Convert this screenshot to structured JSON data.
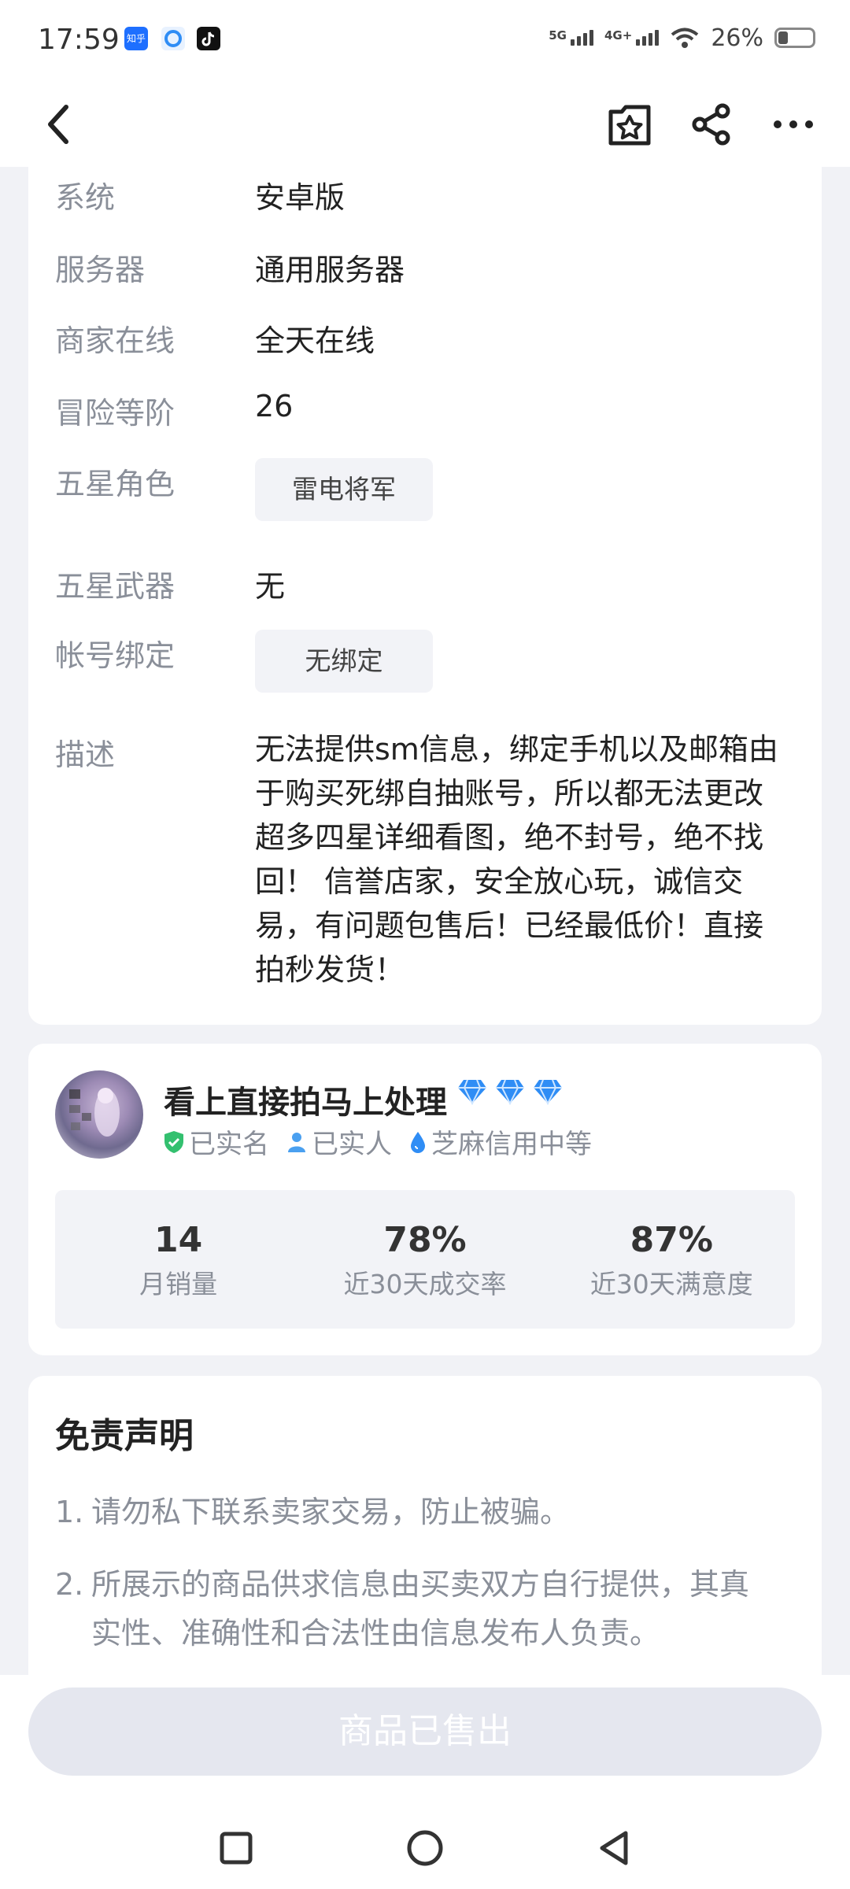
{
  "status_bar": {
    "time": "17:59",
    "app_icons": [
      "zhihu-icon",
      "browser-icon",
      "tiktok-icon"
    ],
    "zhihu_text": "知乎",
    "signal_5g": "5G",
    "signal_4g": "4G+",
    "battery_text": "26%",
    "battery_level": 0.26
  },
  "details": {
    "rows": [
      {
        "label": "系统",
        "value": "安卓版"
      },
      {
        "label": "服务器",
        "value": "通用服务器"
      },
      {
        "label": "商家在线",
        "value": "全天在线"
      },
      {
        "label": "冒险等阶",
        "value": "26"
      },
      {
        "label": "五星角色",
        "value": "雷电将军"
      },
      {
        "label": "五星武器",
        "value": "无"
      },
      {
        "label": "帐号绑定",
        "value": "无绑定"
      }
    ],
    "desc_label": "描述",
    "desc_lines": [
      "无法提供sm信息，绑定手机以及邮箱由",
      "于购买死绑自抽账号，所以都无法更改",
      "超多四星详细看图，绝不封号，绝不找",
      "回！ 信誉店家，安全放心玩，诚信交",
      "易，有问题包售后！已经最低价！直接",
      "拍秒发货！"
    ]
  },
  "seller": {
    "name": "看上直接拍马上处理",
    "badges": {
      "verified": "已实名",
      "real_person": "已实人",
      "credit": "芝麻信用中等"
    },
    "stats": [
      {
        "value": "14",
        "label": "月销量"
      },
      {
        "value": "78%",
        "label": "近30天成交率"
      },
      {
        "value": "87%",
        "label": "近30天满意度"
      }
    ]
  },
  "disclaimer": {
    "title": "免责声明",
    "items": [
      {
        "num": "1.",
        "lines": [
          "请勿私下联系卖家交易，防止被骗。"
        ]
      },
      {
        "num": "2.",
        "lines": [
          "所展示的商品供求信息由买卖双方自行提供，其真",
          "实性、准确性和合法性由信息发布人负责。"
        ]
      }
    ]
  },
  "bottom": {
    "sold_label": "商品已售出"
  },
  "colors": {
    "diamond": "#2f8df5",
    "verified_green": "#33c06f",
    "person_blue": "#4aa0f0",
    "credit_blue": "#2f8df5"
  }
}
